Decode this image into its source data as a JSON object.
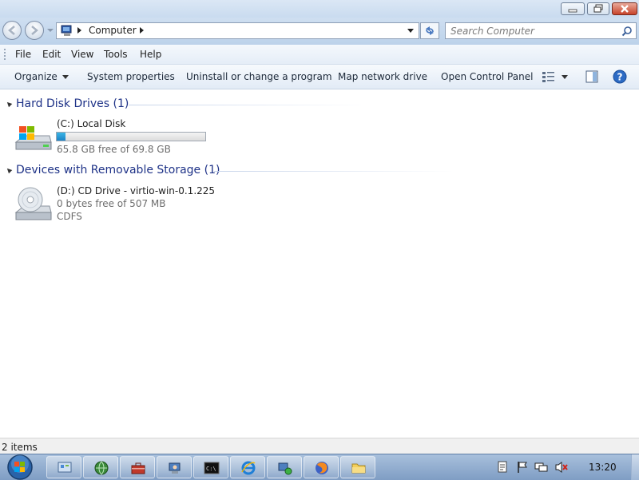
{
  "window": {
    "caption_buttons": [
      "minimize-icon",
      "restore-icon",
      "close-icon"
    ]
  },
  "navigation": {
    "back_icon": "back-arrow-icon",
    "forward_icon": "forward-arrow-icon",
    "address": {
      "location": "Computer"
    },
    "search": {
      "placeholder": "Search Computer"
    }
  },
  "menubar": {
    "items": [
      {
        "label": "File"
      },
      {
        "label": "Edit"
      },
      {
        "label": "View"
      },
      {
        "label": "Tools"
      },
      {
        "label": "Help"
      }
    ]
  },
  "commandbar": {
    "organize": "Organize",
    "items": [
      {
        "label": "System properties"
      },
      {
        "label": "Uninstall or change a program"
      },
      {
        "label": "Map network drive"
      },
      {
        "label": "Open Control Panel"
      }
    ]
  },
  "groups": [
    {
      "header": "Hard Disk Drives (1)",
      "drives": [
        {
          "name": "(C:) Local Disk",
          "free_text": "65.8 GB free of 69.8 GB",
          "used_fraction": 0.057,
          "icon": "hard-disk-icon"
        }
      ]
    },
    {
      "header": "Devices with Removable Storage (1)",
      "drives": [
        {
          "name": "(D:) CD Drive - virtio-win-0.1.225",
          "free_text": "0 bytes free of 507 MB",
          "filesystem": "CDFS",
          "icon": "cd-drive-icon"
        }
      ]
    }
  ],
  "statusbar": {
    "items_count": "2 items"
  },
  "taskbar": {
    "clock": "13:20",
    "pinned": [
      "start-orb-icon",
      "control-panel-icon",
      "network-globe-icon",
      "toolbox-icon",
      "computer-user-icon",
      "command-prompt-icon",
      "internet-explorer-icon",
      "network-folder-icon",
      "firefox-icon",
      "folder-icon"
    ],
    "tray": [
      "document-icon",
      "flag-icon",
      "network-icon",
      "volume-muted-icon"
    ]
  },
  "colors": {
    "group_header": "#1e3287",
    "capacity_fill": "#1c84c6",
    "secondary_text": "#6d6d6d"
  }
}
